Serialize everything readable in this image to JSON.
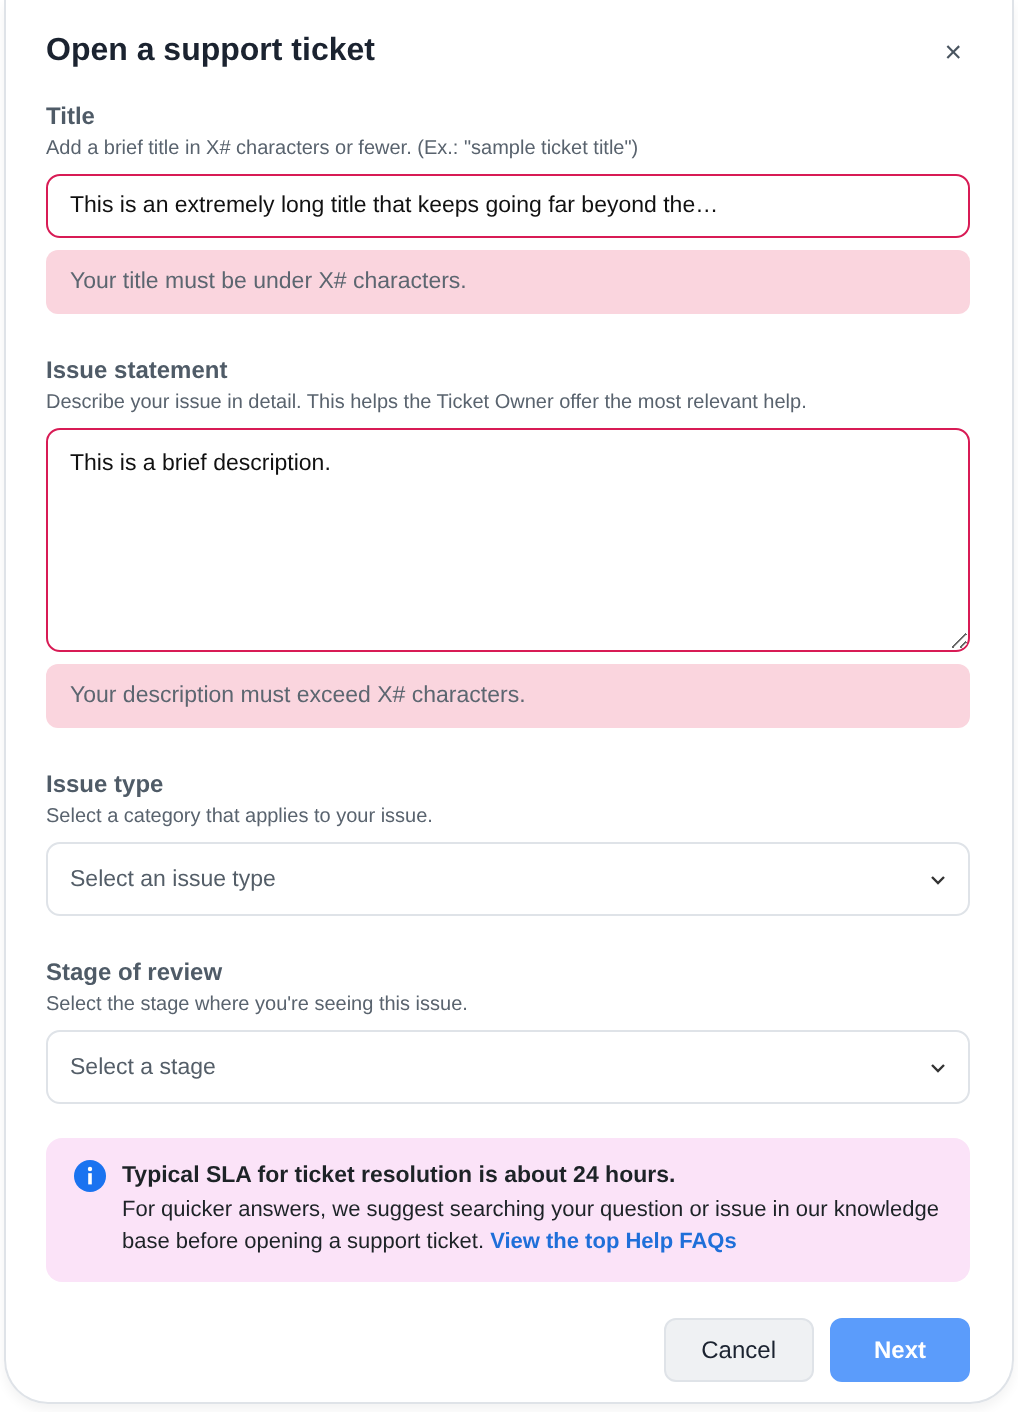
{
  "dialog": {
    "title": "Open a support ticket",
    "close": "×"
  },
  "fields": [
    {
      "kind": "input",
      "label": "Title",
      "hint": "Add a brief title in X# characters or fewer. (Ex.: \"sample ticket title\")",
      "value": "This is an extremely long title that keeps going far beyond the…",
      "invalid": true,
      "error": "Your title must be under X# characters."
    },
    {
      "kind": "textarea",
      "label": "Issue statement",
      "hint": "Describe your issue in detail. This helps the Ticket Owner offer the most relevant help.",
      "value": "This is a brief description.",
      "invalid": true,
      "error": "Your description must exceed X# characters."
    },
    {
      "kind": "select",
      "label": "Issue type",
      "hint": "Select a category that applies to your issue.",
      "placeholder": "Select an issue type",
      "invalid": false
    },
    {
      "kind": "select",
      "label": "Stage of review",
      "hint": "Select the stage where you're seeing this issue.",
      "placeholder": "Select a stage",
      "invalid": false
    }
  ],
  "notice": {
    "heading": "Typical SLA for ticket resolution is about 24 hours.",
    "body": "For quicker answers, we suggest searching your question or issue in our knowledge base before opening a support ticket.",
    "link": "View the top Help FAQs"
  },
  "buttons": [
    {
      "label": "Cancel",
      "kind": "secondary",
      "disabled": false
    },
    {
      "label": "Next",
      "kind": "primary",
      "disabled": true
    }
  ]
}
